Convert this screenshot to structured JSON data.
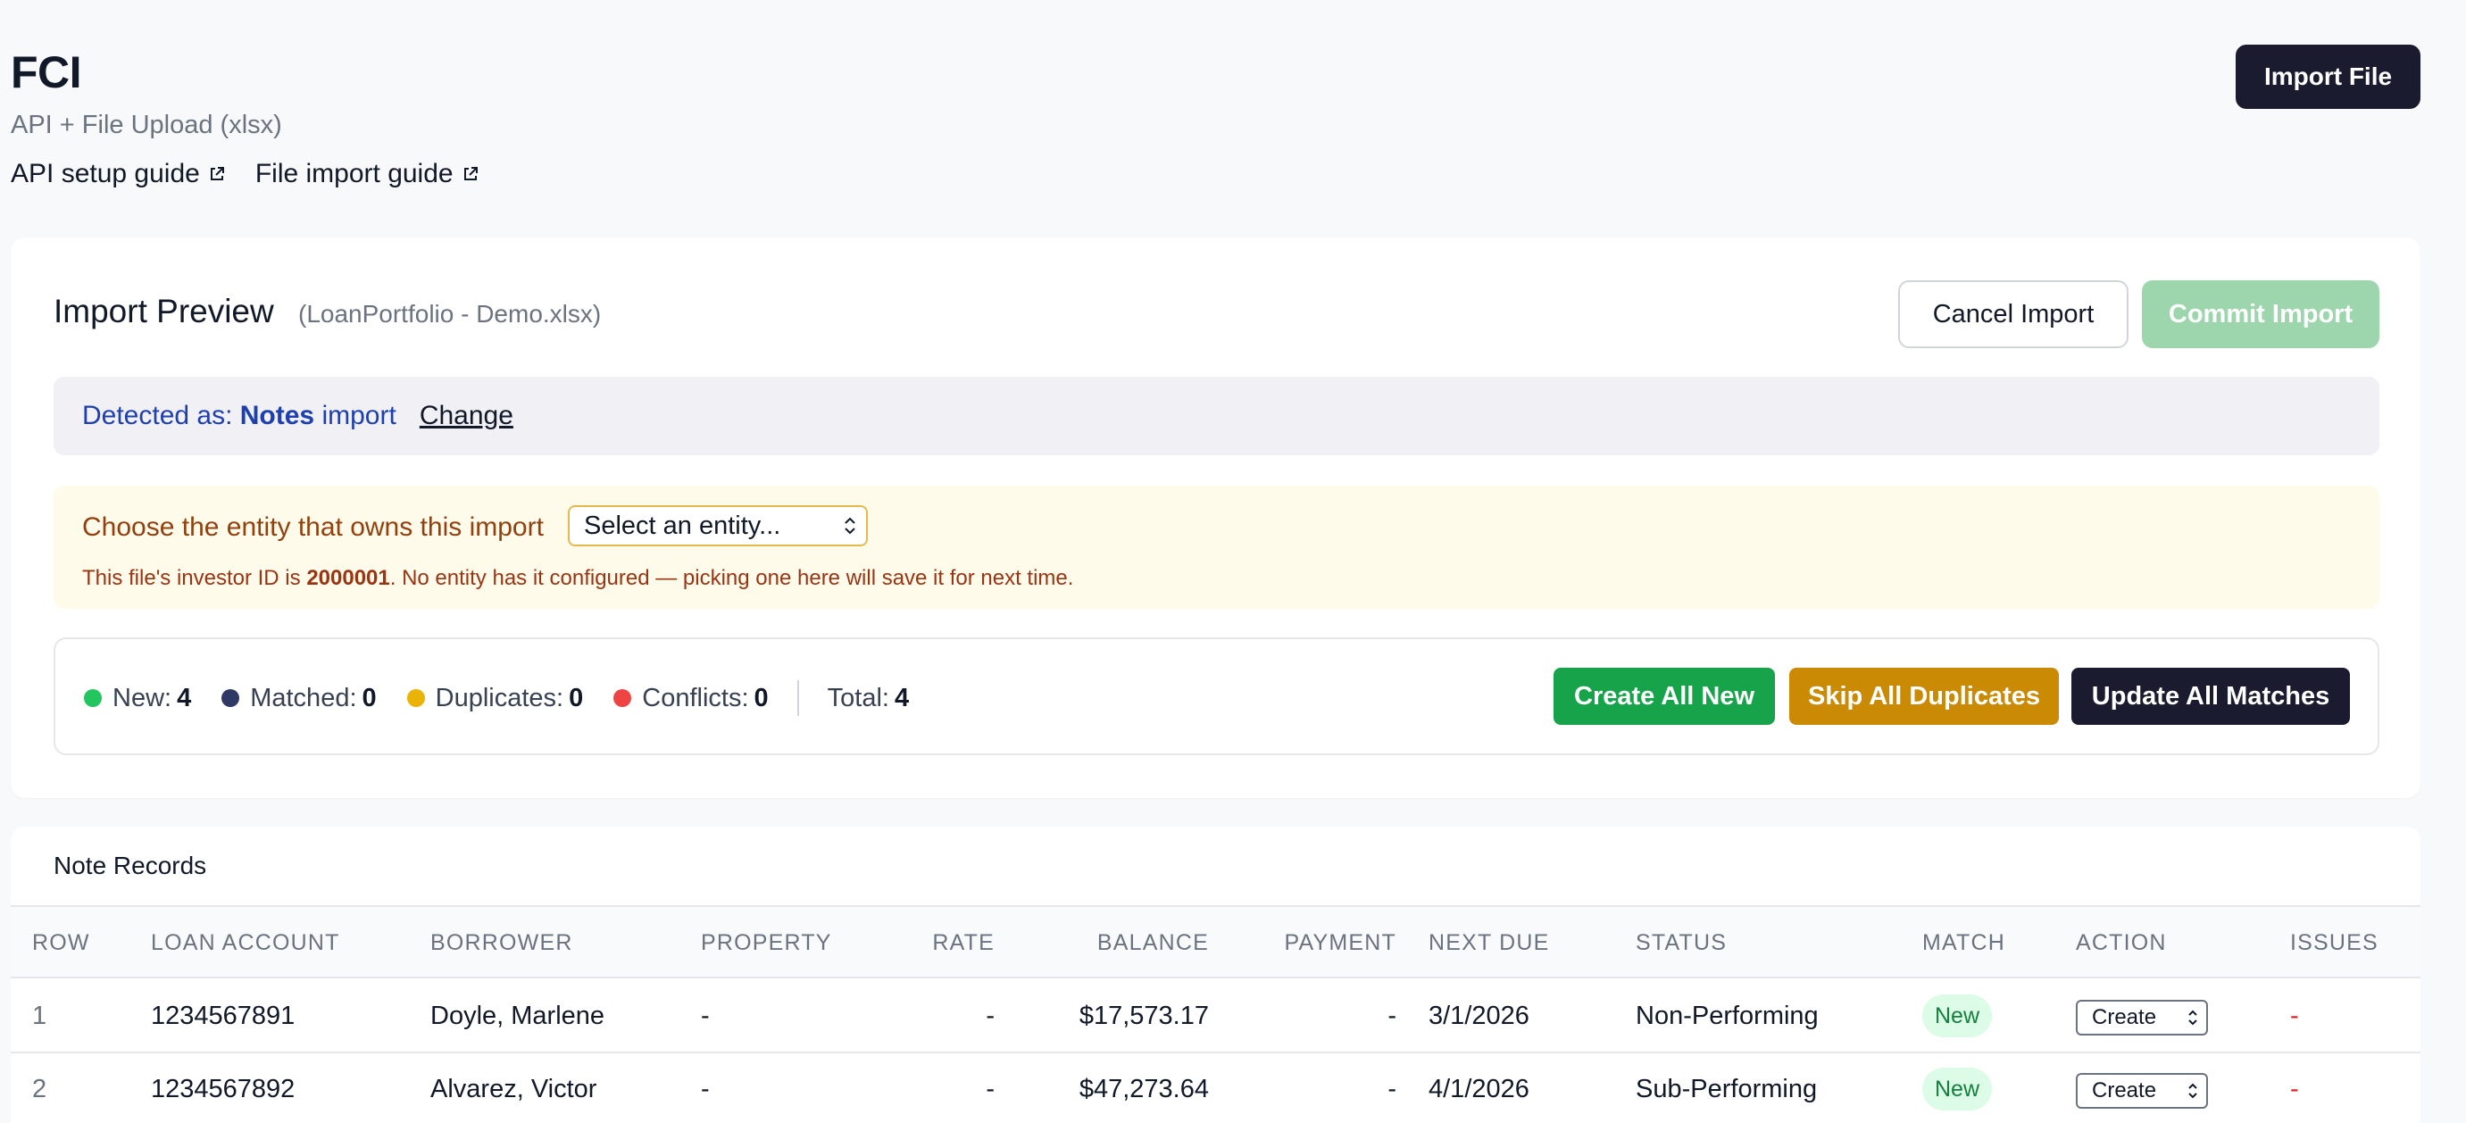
{
  "header": {
    "title": "FCI",
    "subtitle": "API + File Upload (xlsx)",
    "links": [
      {
        "label": "API setup guide",
        "icon": "external-link-icon"
      },
      {
        "label": "File import guide",
        "icon": "external-link-icon"
      }
    ],
    "import_file_label": "Import File"
  },
  "preview": {
    "title": "Import Preview",
    "filename": "(LoanPortfolio - Demo.xlsx)",
    "cancel_label": "Cancel Import",
    "commit_label": "Commit Import",
    "detected_prefix": "Detected as: ",
    "detected_type": "Notes",
    "detected_suffix": " import",
    "change_label": "Change",
    "entity_label": "Choose the entity that owns this import",
    "entity_select_value": "Select an entity...",
    "entity_note_prefix": "This file's investor ID is ",
    "entity_note_id": "2000001",
    "entity_note_suffix": ". No entity has it configured — picking one here will save it for next time."
  },
  "summary": {
    "stats": [
      {
        "label": "New:",
        "value": "4",
        "color": "#22c55e"
      },
      {
        "label": "Matched:",
        "value": "0",
        "color": "#2e3a63"
      },
      {
        "label": "Duplicates:",
        "value": "0",
        "color": "#eab308"
      },
      {
        "label": "Conflicts:",
        "value": "0",
        "color": "#ef4444"
      }
    ],
    "total_label": "Total:",
    "total_value": "4",
    "create_all_label": "Create All New",
    "skip_all_label": "Skip All Duplicates",
    "update_all_label": "Update All Matches"
  },
  "records": {
    "title": "Note Records",
    "columns": [
      "ROW",
      "LOAN ACCOUNT",
      "BORROWER",
      "PROPERTY",
      "RATE",
      "BALANCE",
      "PAYMENT",
      "NEXT DUE",
      "STATUS",
      "MATCH",
      "ACTION",
      "ISSUES"
    ],
    "rows": [
      {
        "row": "1",
        "loan_account": "1234567891",
        "borrower": "Doyle, Marlene",
        "property": "-",
        "rate": "-",
        "balance": "$17,573.17",
        "payment": "-",
        "next_due": "3/1/2026",
        "status": "Non-Performing",
        "match": "New",
        "action": "Create",
        "issues": "-"
      },
      {
        "row": "2",
        "loan_account": "1234567892",
        "borrower": "Alvarez, Victor",
        "property": "-",
        "rate": "-",
        "balance": "$47,273.64",
        "payment": "-",
        "next_due": "4/1/2026",
        "status": "Sub-Performing",
        "match": "New",
        "action": "Create",
        "issues": "-"
      }
    ]
  }
}
